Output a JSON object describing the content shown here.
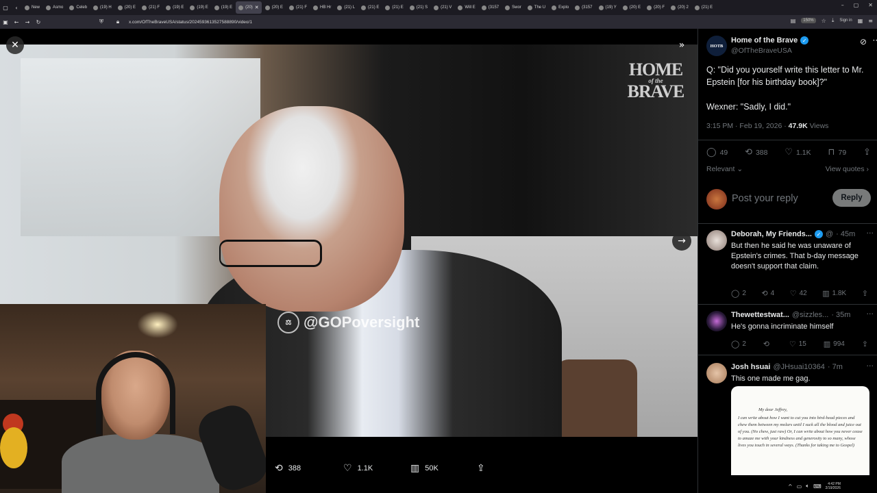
{
  "browser": {
    "tabs": [
      {
        "label": "New"
      },
      {
        "label": "Asmo"
      },
      {
        "label": "Celeb"
      },
      {
        "label": "(19) H"
      },
      {
        "label": "(20) E"
      },
      {
        "label": "(21) F"
      },
      {
        "label": "(19) E"
      },
      {
        "label": "(19) E"
      },
      {
        "label": "(19) E"
      },
      {
        "label": "(20)",
        "active": true
      },
      {
        "label": "(20) E"
      },
      {
        "label": "(21) F"
      },
      {
        "label": "HB Hr"
      },
      {
        "label": "(21) L"
      },
      {
        "label": "(21) E"
      },
      {
        "label": "(21) E"
      },
      {
        "label": "(21) S"
      },
      {
        "label": "(21) V"
      },
      {
        "label": "Will E"
      },
      {
        "label": "(3157"
      },
      {
        "label": "Swor"
      },
      {
        "label": "The U"
      },
      {
        "label": "Explo"
      },
      {
        "label": "(3157"
      },
      {
        "label": "(19) Y"
      },
      {
        "label": "(20) E"
      },
      {
        "label": "(20) F"
      },
      {
        "label": "(20) 2"
      },
      {
        "label": "(21) E"
      }
    ],
    "url": "x.com/OfTheBraveUSA/status/2024593613527588890/video/1",
    "zoom": "150%",
    "sign_in": "Sign in"
  },
  "video": {
    "watermark": "@GOPoversight",
    "logo_top": "HOME",
    "logo_mid": "of the",
    "logo_bottom": "BRAVE",
    "controls": {
      "reposts": "388",
      "likes": "1.1K",
      "views": "50K"
    }
  },
  "tweet": {
    "author_name": "Home of the Brave",
    "author_handle": "@OfTheBraveUSA",
    "avatar_text": "HOTB",
    "text_line1": "Q: \"Did you yourself write this letter to Mr. Epstein [for his birthday book]?\"",
    "text_line2": "Wexner: \"Sadly, I did.\"",
    "time": "3:15 PM · Feb 19, 2026 ·",
    "views_count": "47.9K",
    "views_label": "Views",
    "replies": "49",
    "reposts": "388",
    "likes": "1.1K",
    "bookmarks": "79",
    "sort_label": "Relevant",
    "view_quotes": "View quotes",
    "reply_placeholder": "Post your reply",
    "reply_button": "Reply"
  },
  "replies": [
    {
      "name": "Deborah, My Friends...",
      "handle": "@",
      "time": "· 45m",
      "text": "But then he said he was unaware of Epstein's crimes. That b-day message doesn't support that claim.",
      "replies": "2",
      "reposts": "4",
      "likes": "42",
      "views": "1.8K"
    },
    {
      "name": "Thewettestwat...",
      "handle": "@sizzles...",
      "time": "· 35m",
      "text": "He's gonna incriminate himself",
      "replies": "2",
      "reposts": "",
      "likes": "15",
      "views": "994"
    },
    {
      "name": "Josh hsuai",
      "handle": "@JHsuai10364",
      "time": "· 7m",
      "text": "This one made me gag.",
      "letter_title": "My dear Jeffrey,",
      "letter_body": "I can write about how I want to cut you into bird-head pieces and chew them between my molars until I suck all the blood and juice out of you. (No chew, just raw) Or, I can write about how you never cease to amaze me with your kindness and generosity to so many, whose lives you touch in several ways. (Thanks for taking me to Gospel)"
    }
  ],
  "system": {
    "time": "4:42 PM",
    "date": "2/19/2026"
  }
}
